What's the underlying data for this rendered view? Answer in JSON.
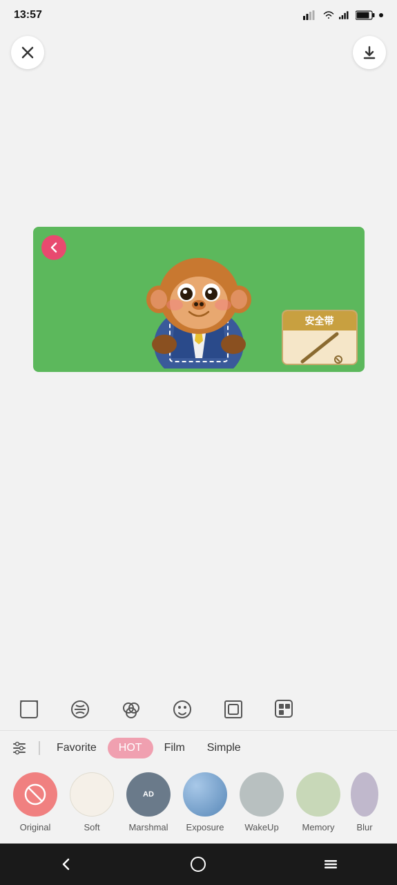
{
  "statusBar": {
    "time": "13:57",
    "icons": [
      "navigation",
      "location",
      "message",
      "mail",
      "dot"
    ]
  },
  "topBar": {
    "closeLabel": "×",
    "downloadLabel": "↓"
  },
  "image": {
    "altText": "Cartoon monkey wearing a blue suit on green background with safety belt card"
  },
  "safetyCard": {
    "title": "安全带",
    "iconAlt": "pencil"
  },
  "toolIcons": [
    {
      "name": "crop-icon",
      "symbol": "⊡"
    },
    {
      "name": "filter-icon",
      "symbol": "⊘"
    },
    {
      "name": "effects-icon",
      "symbol": "⚪"
    },
    {
      "name": "face-icon",
      "symbol": "☺"
    },
    {
      "name": "frame-icon",
      "symbol": "▣"
    },
    {
      "name": "more-icon",
      "symbol": "▣"
    }
  ],
  "filterTabs": {
    "settingsIconSymbol": "⊟",
    "tabs": [
      {
        "label": "Favorite",
        "active": false
      },
      {
        "label": "HOT",
        "active": true
      },
      {
        "label": "Film",
        "active": false
      },
      {
        "label": "Simple",
        "active": false
      }
    ]
  },
  "filterItems": [
    {
      "name": "Original",
      "color": "#f08080",
      "hasIcon": false,
      "iconSymbol": "⊘",
      "iconColor": "#f08080"
    },
    {
      "name": "Soft",
      "color": "#f5f0e8",
      "hasIcon": false
    },
    {
      "name": "Marshmal",
      "color": "#7a8a9a",
      "hasIcon": true,
      "iconSymbol": "AD"
    },
    {
      "name": "Exposure",
      "color": "#7aabcc",
      "hasIcon": false
    },
    {
      "name": "WakeUp",
      "color": "#b0b8b8",
      "hasIcon": false
    },
    {
      "name": "Memory",
      "color": "#d0dcc0",
      "hasIcon": false
    },
    {
      "name": "Blur",
      "color": "#c8c0d0",
      "hasIcon": false
    }
  ],
  "navBar": {
    "backSymbol": "‹",
    "homeSymbol": "○",
    "menuSymbol": "≡"
  }
}
